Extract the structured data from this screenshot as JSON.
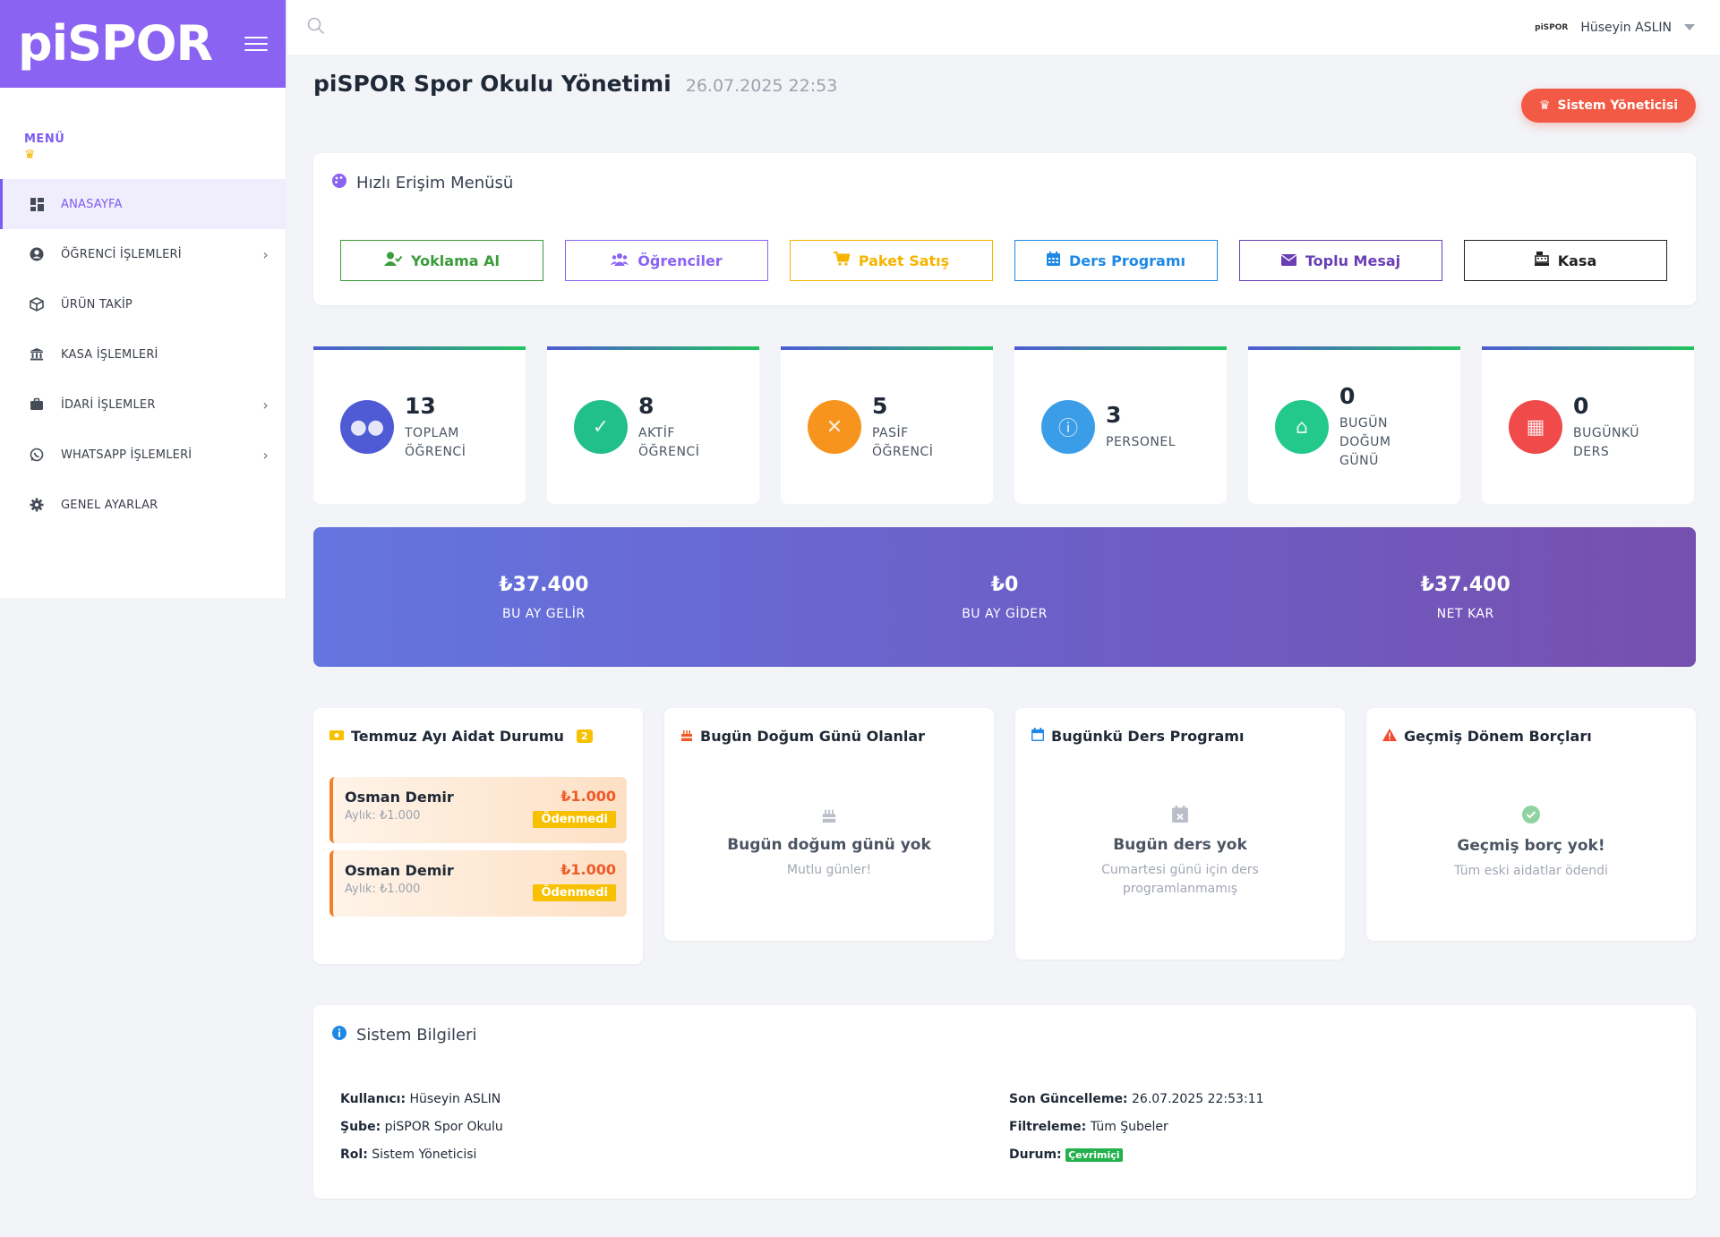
{
  "brand": {
    "logo": "piSPOR"
  },
  "sidebar": {
    "menu_label": "MENÜ",
    "items": [
      {
        "label": "ANASAYFA",
        "icon": "dashboard-icon",
        "active": true,
        "has_children": false
      },
      {
        "label": "ÖĞRENCİ İŞLEMLERİ",
        "icon": "user-circle-icon",
        "active": false,
        "has_children": true
      },
      {
        "label": "ÜRÜN TAKİP",
        "icon": "box-icon",
        "active": false,
        "has_children": false
      },
      {
        "label": "KASA İŞLEMLERİ",
        "icon": "bank-icon",
        "active": false,
        "has_children": false
      },
      {
        "label": "İDARİ İŞLEMLER",
        "icon": "briefcase-icon",
        "active": false,
        "has_children": true
      },
      {
        "label": "WHATSAPP İŞLEMLERİ",
        "icon": "whatsapp-icon",
        "active": false,
        "has_children": true
      },
      {
        "label": "GENEL AYARLAR",
        "icon": "gear-icon",
        "active": false,
        "has_children": false
      }
    ]
  },
  "topbar": {
    "mini_logo": "piSPOR",
    "user_name": "Hüseyin ASLIN"
  },
  "page": {
    "title": "piSPOR Spor Okulu Yönetimi",
    "datetime": "26.07.2025 22:53",
    "role_button": "Sistem Yöneticisi"
  },
  "quick_access": {
    "title": "Hızlı Erişim Menüsü",
    "buttons": [
      {
        "label": "Yoklama Al",
        "color": "#3a9d3a"
      },
      {
        "label": "Öğrenciler",
        "color": "#8a63f3"
      },
      {
        "label": "Paket Satış",
        "color": "#f5b400"
      },
      {
        "label": "Ders Programı",
        "color": "#1e88e5"
      },
      {
        "label": "Toplu Mesaj",
        "color": "#6a3fb6"
      },
      {
        "label": "Kasa",
        "color": "#222222"
      }
    ]
  },
  "stats": [
    {
      "value": "13",
      "label1": "TOPLAM",
      "label2": "ÖĞRENCİ",
      "color": "#4f5bd5"
    },
    {
      "value": "8",
      "label1": "AKTİF",
      "label2": "ÖĞRENCİ",
      "color": "#21c08b"
    },
    {
      "value": "5",
      "label1": "PASİF",
      "label2": "ÖĞRENCİ",
      "color": "#f7941d"
    },
    {
      "value": "3",
      "label1": "PERSONEL",
      "label2": "",
      "color": "#3b9de8"
    },
    {
      "value": "0",
      "label1": "BUGÜN",
      "label2": "DOĞUM GÜNÜ",
      "color": "#22c98a"
    },
    {
      "value": "0",
      "label1": "BUGÜNKÜ",
      "label2": "DERS",
      "color": "#f04a4a"
    }
  ],
  "finance": [
    {
      "value": "₺37.400",
      "label": "BU AY GELİR"
    },
    {
      "value": "₺0",
      "label": "BU AY GİDER"
    },
    {
      "value": "₺37.400",
      "label": "NET KAR"
    }
  ],
  "fees": {
    "title": "Temmuz Ayı Aidat Durumu",
    "count": "2",
    "items": [
      {
        "name": "Osman Demir",
        "monthly": "Aylık: ₺1.000",
        "amount": "₺1.000",
        "status": "Ödenmedi"
      },
      {
        "name": "Osman Demir",
        "monthly": "Aylık: ₺1.000",
        "amount": "₺1.000",
        "status": "Ödenmedi"
      }
    ]
  },
  "birthdays": {
    "title": "Bugün Doğum Günü Olanlar",
    "empty_title": "Bugün doğum günü yok",
    "empty_sub": "Mutlu günler!"
  },
  "schedule": {
    "title": "Bugünkü Ders Programı",
    "empty_title": "Bugün ders yok",
    "empty_sub": "Cumartesi günü için ders programlanmamış"
  },
  "debts": {
    "title": "Geçmiş Dönem Borçları",
    "empty_title": "Geçmiş borç yok!",
    "empty_sub": "Tüm eski aidatlar ödendi"
  },
  "system": {
    "title": "Sistem Bilgileri",
    "user_label": "Kullanıcı:",
    "user_value": "Hüseyin ASLIN",
    "branch_label": "Şube:",
    "branch_value": "piSPOR Spor Okulu",
    "role_label": "Rol:",
    "role_value": "Sistem Yöneticisi",
    "updated_label": "Son Güncelleme:",
    "updated_value": "26.07.2025 22:53:11",
    "filter_label": "Filtreleme:",
    "filter_value": "Tüm Şubeler",
    "status_label": "Durum:",
    "status_value": "Çevrimiçi"
  }
}
